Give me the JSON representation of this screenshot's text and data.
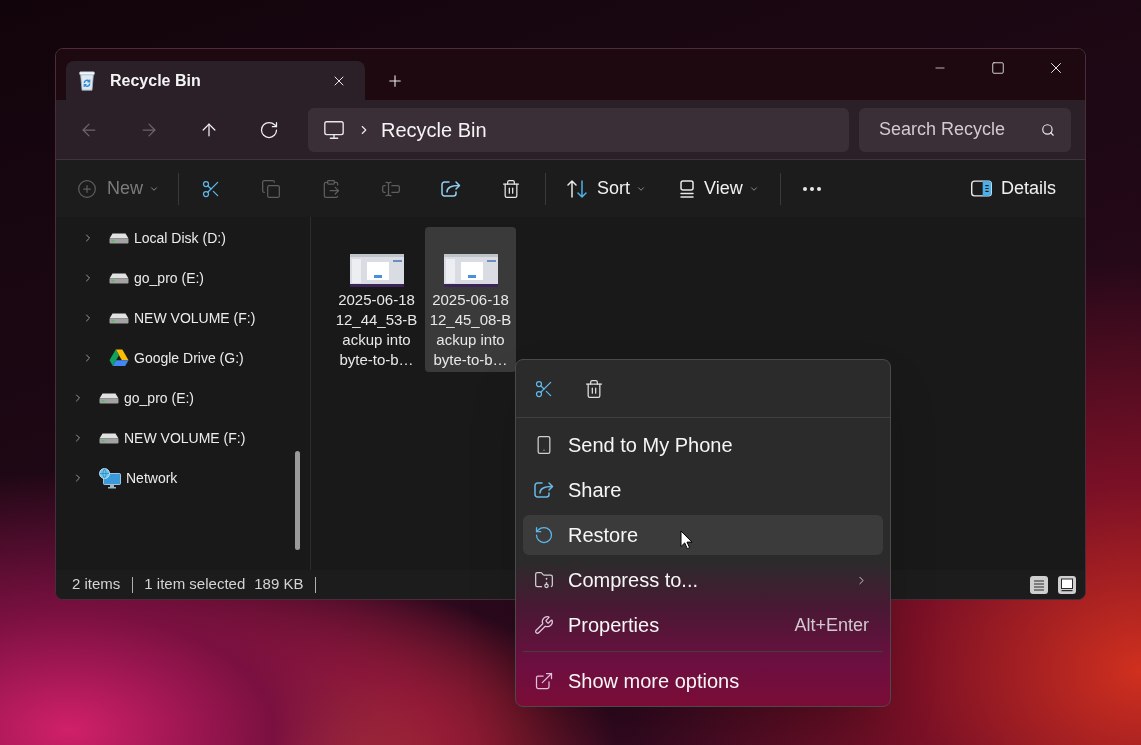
{
  "window": {
    "tabs": [
      {
        "title": "Recycle Bin",
        "selected": true
      }
    ]
  },
  "nav_buttons": [
    {
      "disabled": true
    },
    {
      "disabled": true
    },
    {
      "disabled": false
    },
    {
      "disabled": false
    }
  ],
  "address_bar": {
    "segments": [
      "Recycle Bin"
    ]
  },
  "search": {
    "placeholder": "Search Recycle"
  },
  "toolbar": {
    "groups": [
      {
        "items": [
          {
            "label": "New",
            "disabled": true,
            "dropdown": true
          }
        ]
      },
      {
        "items": [
          {
            "disabled": false
          },
          {
            "disabled": true
          },
          {
            "disabled": true
          },
          {
            "disabled": true
          },
          {
            "disabled": false
          },
          {
            "disabled": false
          }
        ]
      },
      {
        "items": [
          {
            "label": "Sort",
            "disabled": false,
            "dropdown": true
          },
          {
            "label": "View",
            "disabled": false,
            "dropdown": true
          }
        ]
      },
      {
        "items": [
          {
            "disabled": false
          }
        ]
      }
    ],
    "details_button": {
      "label": "Details"
    }
  },
  "sidebar": {
    "items": [
      {
        "children": [
          {
            "label": "Local Disk (D:)",
            "kind": "drive",
            "expanded": false
          },
          {
            "label": "go_pro (E:)",
            "kind": "drive",
            "expanded": false
          },
          {
            "label": "NEW VOLUME (F:)",
            "kind": "drive",
            "expanded": false
          },
          {
            "label": "Google Drive (G:)",
            "kind": "cloud_drive",
            "expanded": false
          }
        ]
      },
      {
        "label": "go_pro (E:)",
        "kind": "drive",
        "expanded": false
      },
      {
        "label": "NEW VOLUME (F:)",
        "kind": "drive",
        "expanded": false
      },
      {
        "label": "Network",
        "kind": "network",
        "expanded": false
      }
    ]
  },
  "files": [
    {
      "name_lines": [
        "2025-06-18",
        "12_44_53-B",
        "ackup into",
        "byte-to-b…"
      ],
      "selected": false
    },
    {
      "name_lines": [
        "2025-06-18",
        "12_45_08-B",
        "ackup into",
        "byte-to-b…"
      ],
      "selected": true
    }
  ],
  "status_bar": {
    "item_count": "2 items",
    "selection": "1 item selected",
    "size": "189 KB"
  },
  "context_menu": {
    "sections": [
      {
        "items": [
          {
            "label": "Send to My Phone",
            "highlighted": false,
            "submenu": false
          },
          {
            "label": "Share",
            "highlighted": false,
            "submenu": false
          },
          {
            "label": "Restore",
            "highlighted": true,
            "submenu": false
          },
          {
            "label": "Compress to...",
            "highlighted": false,
            "submenu": true
          },
          {
            "label": "Properties",
            "shortcut": "Alt+Enter",
            "highlighted": false,
            "submenu": false
          }
        ]
      },
      {
        "items": [
          {
            "label": "Show more options",
            "highlighted": false,
            "submenu": false
          }
        ]
      }
    ]
  }
}
